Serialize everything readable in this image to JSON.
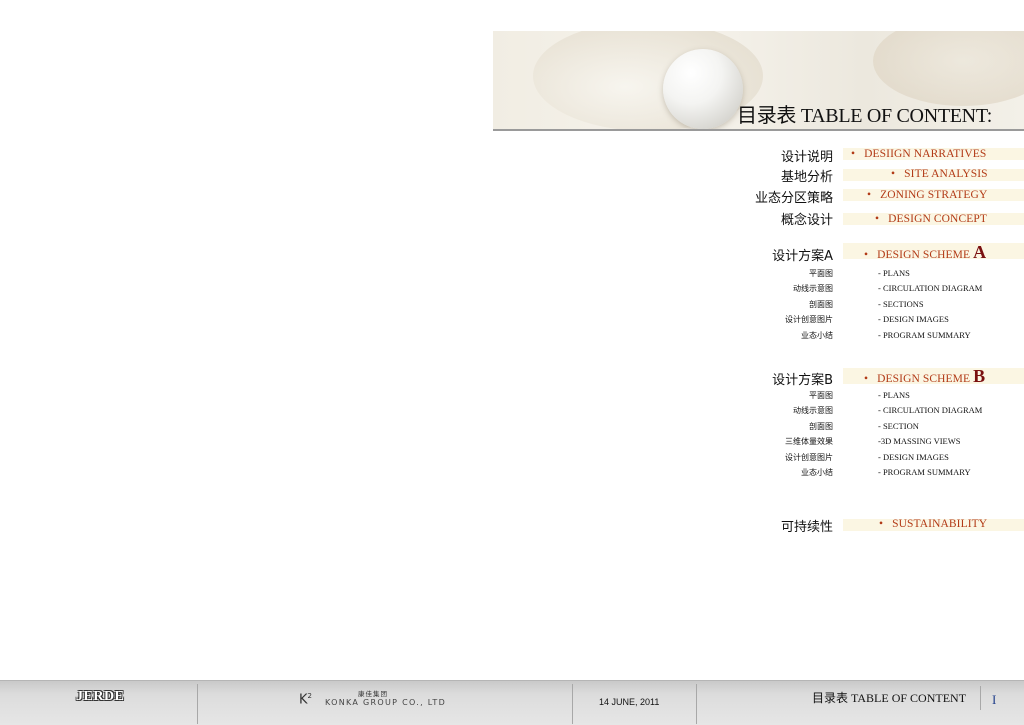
{
  "header": {
    "title": "目录表 TABLE OF CONTENT:"
  },
  "sections": [
    {
      "cn": "设计说明",
      "en": "DESIIGN NARRATIVES"
    },
    {
      "cn": "基地分析",
      "en": "SITE ANALYSIS"
    },
    {
      "cn": "业态分区策略",
      "en": "ZONING STRATEGY"
    },
    {
      "cn": "概念设计",
      "en": "DESIGN CONCEPT"
    }
  ],
  "scheme_a": {
    "cn": "设计方案A",
    "en": "DESIGN SCHEME",
    "letter": "A",
    "items": [
      {
        "cn": "平面图",
        "en": "- PLANS"
      },
      {
        "cn": "动线示意图",
        "en": "- CIRCULATION DIAGRAM"
      },
      {
        "cn": "剖面图",
        "en": "- SECTIONS"
      },
      {
        "cn": "设计创意图片",
        "en": "- DESIGN IMAGES"
      },
      {
        "cn": "业态小结",
        "en": "- PROGRAM SUMMARY"
      }
    ]
  },
  "scheme_b": {
    "cn": "设计方案B",
    "en": "DESIGN SCHEME",
    "letter": "B",
    "items": [
      {
        "cn": "平面图",
        "en": "- PLANS"
      },
      {
        "cn": "动线示意图",
        "en": "- CIRCULATION DIAGRAM"
      },
      {
        "cn": "剖面图",
        "en": "- SECTION"
      },
      {
        "cn": "三维体量效果",
        "en": "-3D MASSING VIEWS"
      },
      {
        "cn": "设计创意图片",
        "en": "- DESIGN IMAGES"
      },
      {
        "cn": "业态小结",
        "en": "- PROGRAM SUMMARY"
      }
    ]
  },
  "sustainability": {
    "cn": "可持续性",
    "en": "SUSTAINABILITY"
  },
  "footer": {
    "jerde": "JERDE",
    "k2": "K",
    "k2_sup": "2",
    "konka_cn": "康佳集团",
    "konka_en": "KONKA GROUP CO., LTD",
    "date": "14 JUNE, 2011",
    "toc": "目录表 TABLE OF CONTENT",
    "page": "I"
  },
  "colors": {
    "accent": "#b23a16",
    "scheme_letter": "#7a1010",
    "highlight_bar": "#fbf6e3",
    "page_number": "#1f3e8a"
  }
}
